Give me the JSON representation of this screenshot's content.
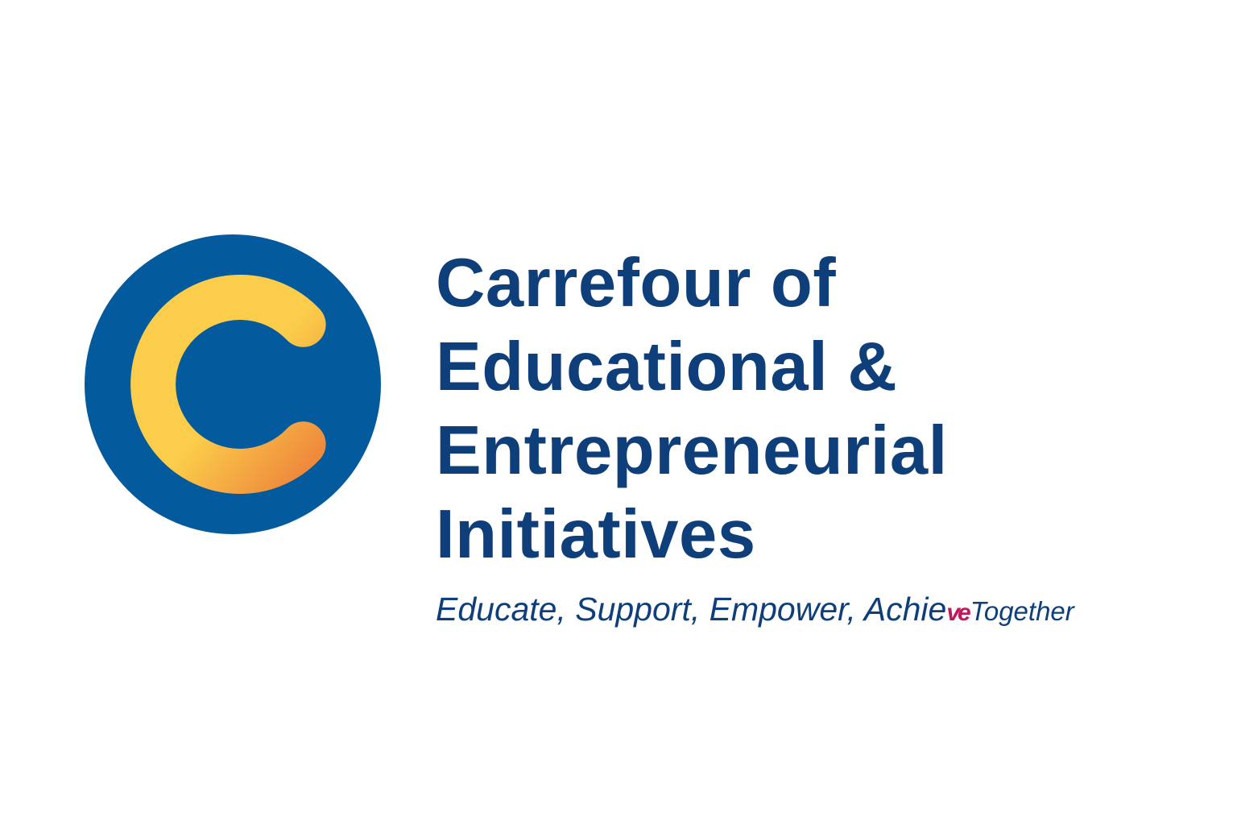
{
  "brand": {
    "logo_icon": "letter-c-ring-icon",
    "colors": {
      "circle": "#035a9c",
      "c_top": "#fbcd4a",
      "c_bottom": "#ef8a3c",
      "text": "#0e3f7a",
      "accent": "#c2185b"
    },
    "name_lines": [
      "Carrefour of",
      "Educational &",
      "Entrepreneurial",
      "Initiatives"
    ],
    "tagline": {
      "main": "Educate, Support, Empower, Achie",
      "mark": "ve",
      "end": "Together"
    }
  }
}
